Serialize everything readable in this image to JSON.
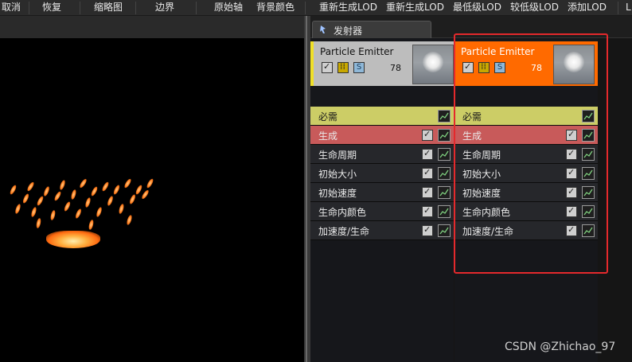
{
  "toolbar": {
    "items": [
      "取消",
      "恢复",
      "缩略图",
      "边界",
      "原始轴",
      "背景颜色",
      "重新生成LOD",
      "重新生成LOD",
      "最低级LOD",
      "较低级LOD",
      "添加LOD",
      "L"
    ]
  },
  "emitters_panel": {
    "tab_label": "发射器",
    "emitters": [
      {
        "name": "Particle Emitter",
        "count": "78",
        "modules": [
          {
            "label": "必需"
          },
          {
            "label": "生成"
          },
          {
            "label": "生命周期"
          },
          {
            "label": "初始大小"
          },
          {
            "label": "初始速度"
          },
          {
            "label": "生命内颜色"
          },
          {
            "label": "加速度/生命"
          }
        ]
      },
      {
        "name": "Particle Emitter",
        "count": "78",
        "modules": [
          {
            "label": "必需"
          },
          {
            "label": "生成"
          },
          {
            "label": "生命周期"
          },
          {
            "label": "初始大小"
          },
          {
            "label": "初始速度"
          },
          {
            "label": "生命内颜色"
          },
          {
            "label": "加速度/生命"
          }
        ]
      }
    ]
  },
  "watermark": "CSDN @Zhichao_97",
  "colors": {
    "selected_emitter": "#ff6a00",
    "required_module": "#cccd66",
    "spawn_module": "#c85a5a",
    "highlight_box": "#e4292c"
  }
}
